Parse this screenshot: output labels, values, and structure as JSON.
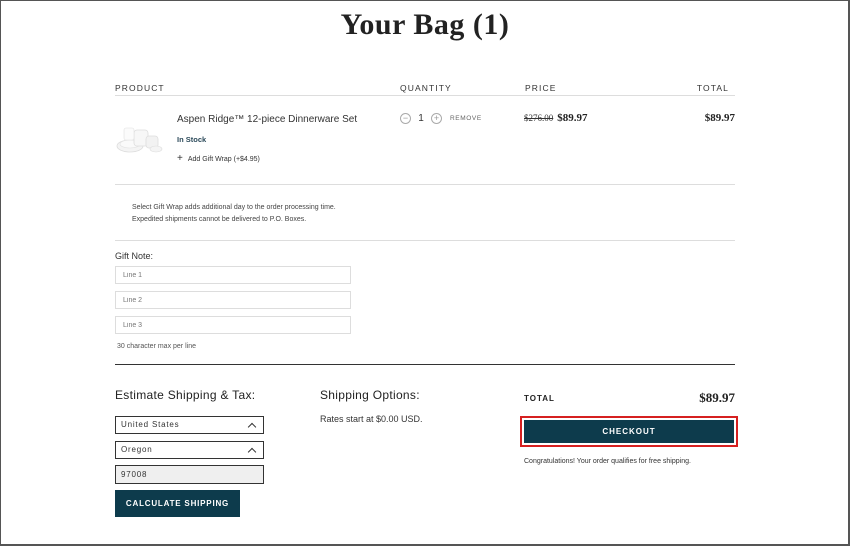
{
  "page": {
    "title": "Your Bag (1)"
  },
  "columns": {
    "product": "PRODUCT",
    "quantity": "QUANTITY",
    "price": "PRICE",
    "total": "TOTAL"
  },
  "item": {
    "name": "Aspen Ridge™ 12-piece Dinnerware Set",
    "stock": "In Stock",
    "gift_wrap": "Add Gift Wrap (+$4.95)",
    "quantity": "1",
    "remove": "REMOVE",
    "price_original": "$276.00",
    "price_sale": "$89.97",
    "line_total": "$89.97"
  },
  "notice": {
    "line1": "Select Gift Wrap adds additional day to the order processing time.",
    "line2": "Expedited shipments cannot be delivered to P.O. Boxes."
  },
  "gift_note": {
    "label": "Gift Note:",
    "line1_placeholder": "Line 1",
    "line2_placeholder": "Line 2",
    "line3_placeholder": "Line 3",
    "hint": "30 character max per line"
  },
  "shipping_estimate": {
    "heading": "Estimate Shipping & Tax:",
    "country": "United States",
    "state": "Oregon",
    "zip": "97008",
    "button": "CALCULATE SHIPPING"
  },
  "shipping_options": {
    "heading": "Shipping Options:",
    "rates": "Rates start at $0.00 USD."
  },
  "summary": {
    "total_label": "TOTAL",
    "total_value": "$89.97",
    "checkout": "CHECKOUT",
    "congrats": "Congratulations! Your order qualifies for free shipping."
  },
  "icons": {
    "minus": "minus-icon",
    "plus": "plus-icon",
    "chevron": "chevron-up-icon",
    "product_image": "dinnerware-image"
  }
}
